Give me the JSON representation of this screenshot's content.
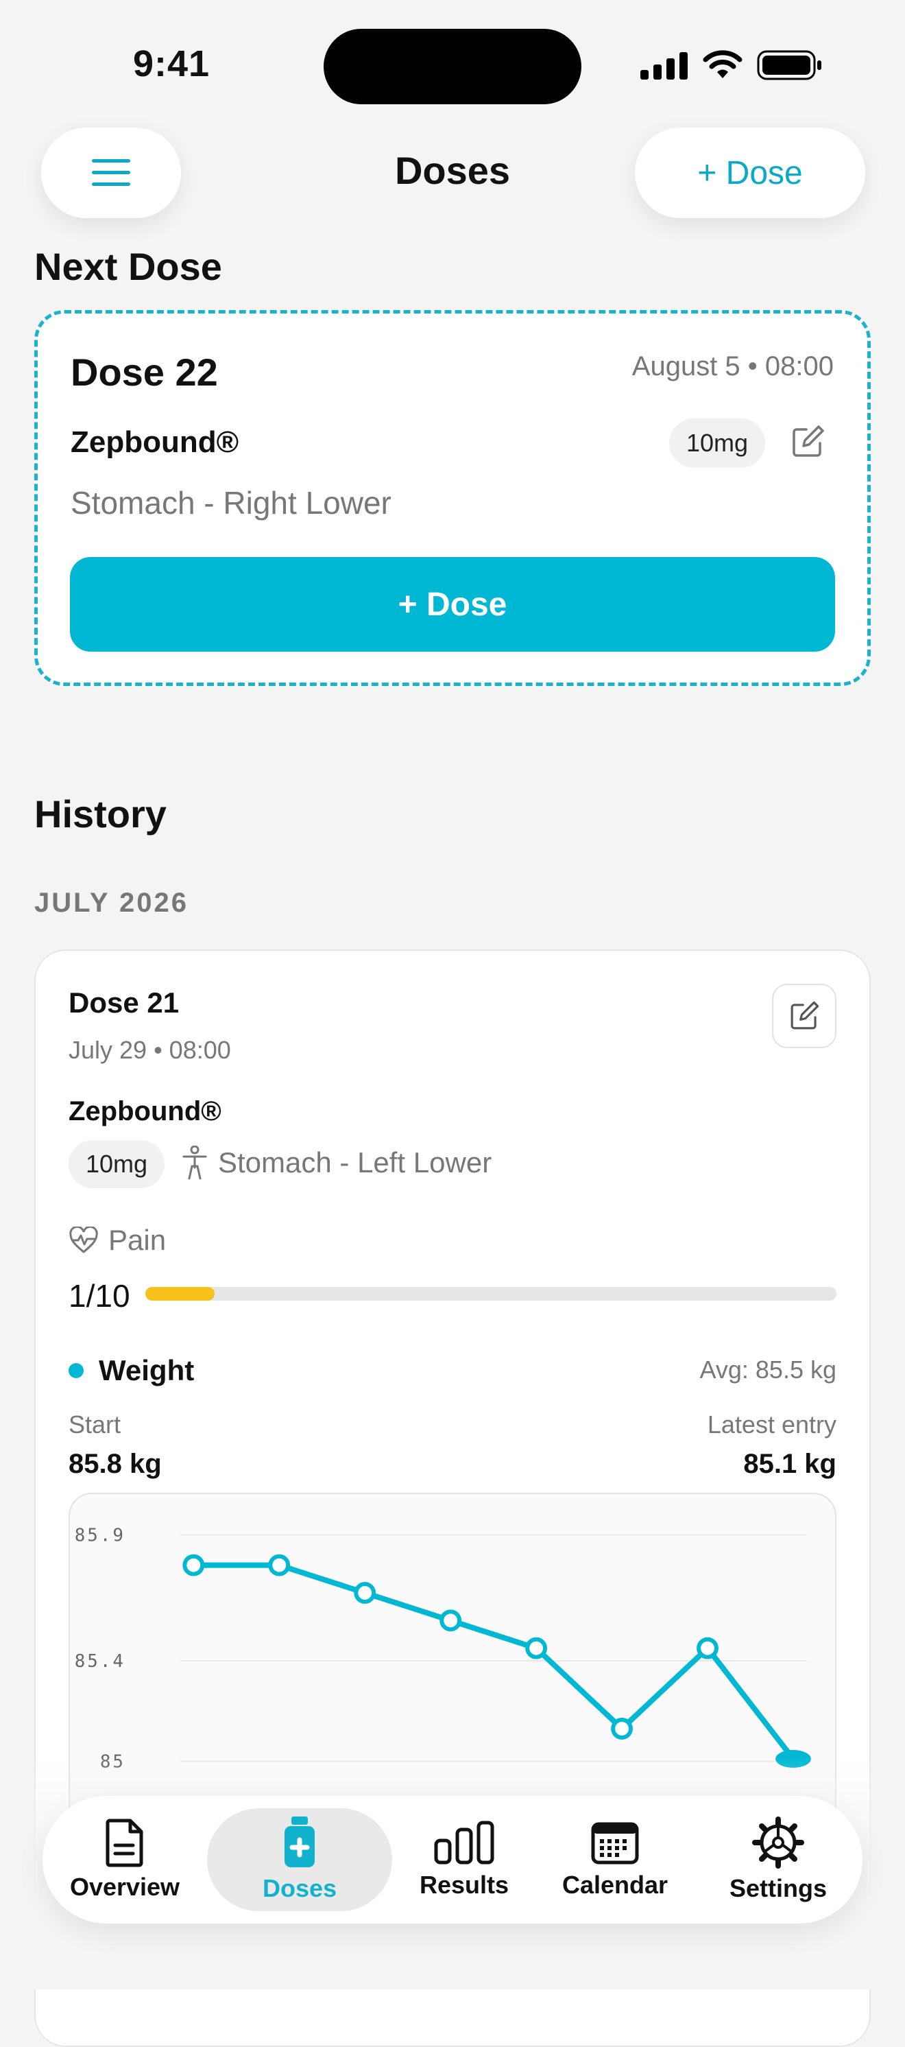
{
  "status_bar": {
    "time": "9:41"
  },
  "header": {
    "title": "Doses",
    "add_button_label": "+ Dose"
  },
  "next_dose": {
    "section_title": "Next Dose",
    "title": "Dose 22",
    "datetime": "August 5 • 08:00",
    "medication": "Zepbound®",
    "dosage": "10mg",
    "site": "Stomach - Right Lower",
    "action_label": "+ Dose"
  },
  "history": {
    "section_title": "History",
    "month_label": "JULY 2026",
    "entry": {
      "title": "Dose 21",
      "datetime": "July 29 • 08:00",
      "medication": "Zepbound®",
      "dosage": "10mg",
      "site": "Stomach - Left Lower",
      "pain_label": "Pain",
      "pain_value_text": "1/10",
      "pain_fraction": 0.1,
      "weight_label": "Weight",
      "weight_avg": "Avg: 85.5 kg",
      "start_label": "Start",
      "start_value": "85.8 kg",
      "latest_label": "Latest entry",
      "latest_value": "85.1 kg"
    }
  },
  "chart_data": {
    "type": "line",
    "y_ticks": [
      "85.9",
      "85.4",
      "85"
    ],
    "ylim": [
      85,
      85.9
    ],
    "grid": true,
    "series": [
      {
        "values": [
          85.78,
          85.78,
          85.67,
          85.56,
          85.45,
          85.13,
          85.45,
          85.01
        ]
      }
    ]
  },
  "tabs": [
    {
      "label": "Overview",
      "icon": "document-icon"
    },
    {
      "label": "Doses",
      "icon": "vial-icon",
      "active": true
    },
    {
      "label": "Results",
      "icon": "bar-chart-icon"
    },
    {
      "label": "Calendar",
      "icon": "calendar-icon"
    },
    {
      "label": "Settings",
      "icon": "gear-icon"
    }
  ],
  "colors": {
    "accent": "#00b8d4",
    "pain": "#f5c21b",
    "background": "#f4f4f4"
  }
}
